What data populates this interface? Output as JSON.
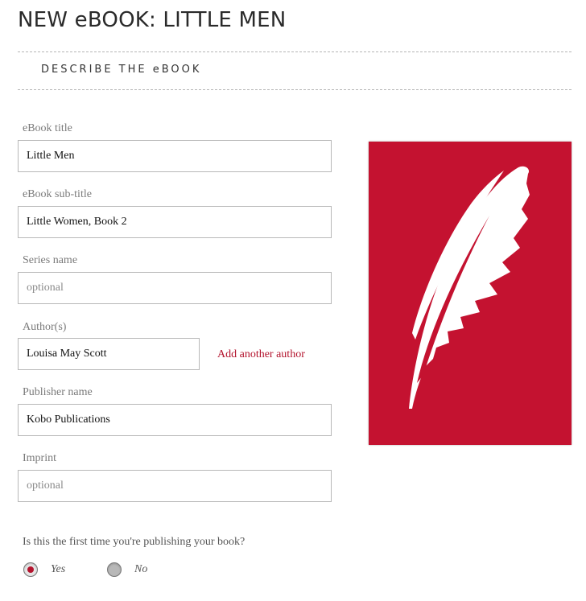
{
  "page": {
    "title": "NEW eBOOK: LITTLE MEN"
  },
  "section": {
    "label": "DESCRIBE THE eBOOK"
  },
  "form": {
    "title": {
      "label": "eBook title",
      "value": "Little Men",
      "placeholder": ""
    },
    "subtitle": {
      "label": "eBook sub-title",
      "value": "Little Women, Book 2",
      "placeholder": ""
    },
    "series": {
      "label": "Series name",
      "value": "",
      "placeholder": "optional"
    },
    "authors": {
      "label": "Author(s)",
      "value": "Louisa May Scott",
      "placeholder": "",
      "add_link": "Add another author"
    },
    "publisher": {
      "label": "Publisher name",
      "value": "Kobo Publications",
      "placeholder": ""
    },
    "imprint": {
      "label": "Imprint",
      "value": "",
      "placeholder": "optional"
    },
    "first_time": {
      "question": "Is this the first time you're publishing your book?",
      "options": [
        {
          "label": "Yes",
          "selected": true
        },
        {
          "label": "No",
          "selected": false
        }
      ]
    }
  },
  "cover": {
    "icon": "feather-quill-icon",
    "background_color": "#c41230",
    "icon_color": "#ffffff"
  },
  "colors": {
    "accent": "#b3132d"
  }
}
